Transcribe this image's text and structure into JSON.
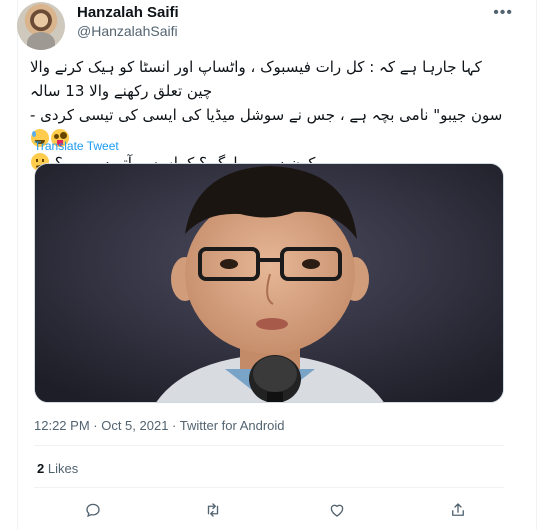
{
  "tweet": {
    "author_name": "Hanzalah Saifi",
    "author_handle": "@HanzalahSaifi",
    "more_label": "•••",
    "text_line1": "کہا جارہا ہے کہ : کل رات فیسبوک ، واٹساپ اور انسٹا کو ہیک کرنے والا چین تعلق رکھنے والا 13 سالہ",
    "text_line2": "سون جیبو\" نامی بچہ ہے ، جس نے سوشل میڈیا کی ایسی کی تیسی کردی -",
    "text_line3": "کون ہیں یہ لوگ ؟ کہاں سے آتے ہیں یہ ؟",
    "translate_label": "Translate Tweet",
    "time": "12:22 PM",
    "date": "Oct 5, 2021",
    "source": "Twitter for Android",
    "likes_count": "2",
    "likes_label": "Likes"
  },
  "icons": {
    "reply": "reply-icon",
    "retweet": "retweet-icon",
    "like": "heart-icon",
    "share": "share-icon"
  },
  "colors": {
    "link": "#1d9bf0",
    "secondary_text": "#536471",
    "primary_text": "#0f1419"
  }
}
